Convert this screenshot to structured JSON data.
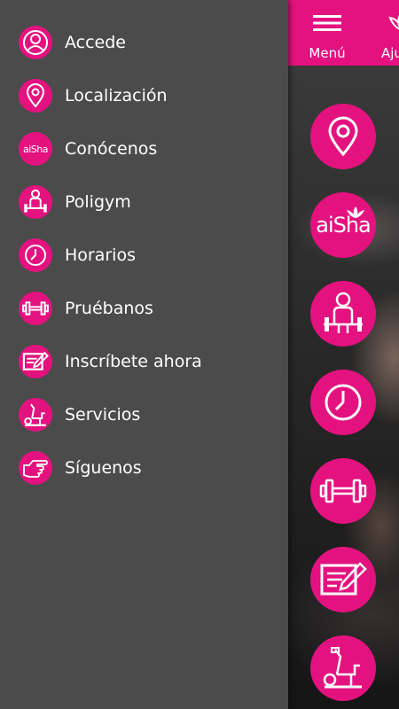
{
  "header": {
    "menu_label": "Menú",
    "adjust_label": "Aju"
  },
  "drawer": {
    "items": [
      {
        "label": "Accede",
        "icon": "user-icon"
      },
      {
        "label": "Localización",
        "icon": "location-pin-icon"
      },
      {
        "label": "Conócenos",
        "icon": "aisha-logo-icon"
      },
      {
        "label": "Poligym",
        "icon": "weightlifter-icon"
      },
      {
        "label": "Horarios",
        "icon": "clock-icon"
      },
      {
        "label": "Pruébanos",
        "icon": "dumbbell-icon"
      },
      {
        "label": "Inscríbete ahora",
        "icon": "signup-form-icon"
      },
      {
        "label": "Servicios",
        "icon": "exercise-bike-icon"
      },
      {
        "label": "Síguenos",
        "icon": "pointing-hand-icon"
      }
    ]
  },
  "logo": {
    "text": "aiSha"
  },
  "colors": {
    "accent": "#e4127f",
    "drawer_bg": "#4b4b4b",
    "text": "#ffffff"
  }
}
